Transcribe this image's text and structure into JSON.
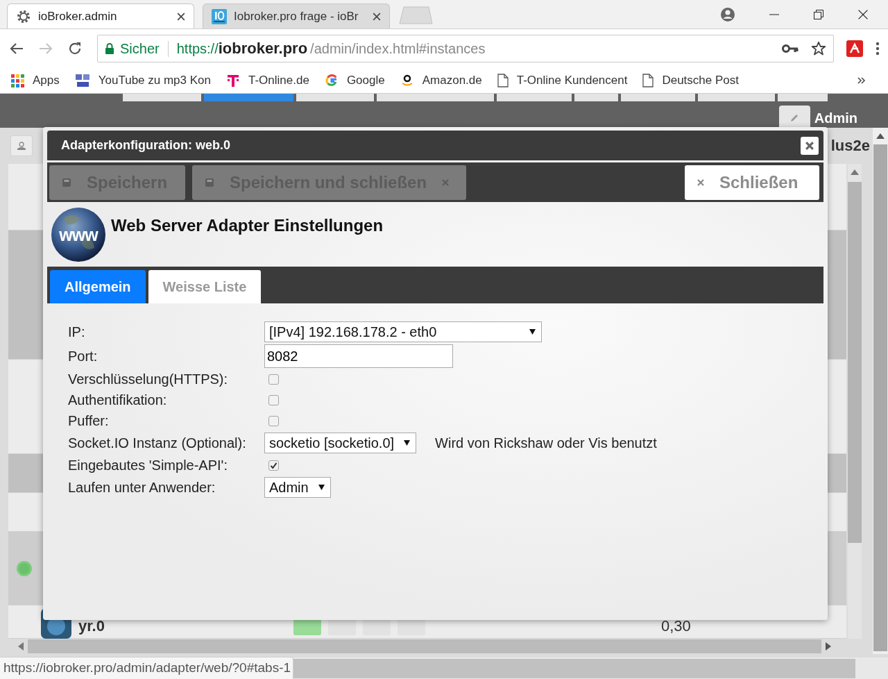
{
  "browser": {
    "tabs": [
      {
        "title": "ioBroker.admin",
        "kind": "gear",
        "selected": true
      },
      {
        "title": "Iobroker.pro frage - ioBr",
        "kind": "site",
        "selected": false
      }
    ],
    "address": {
      "security": "Sicher",
      "scheme": "https://",
      "host": "iobroker.pro",
      "path": "/admin/index.html#instances"
    },
    "bookmarks": [
      {
        "label": "Apps",
        "kind": "apps"
      },
      {
        "label": "YouTube zu mp3 Kon",
        "kind": "mp3"
      },
      {
        "label": "T-Online.de",
        "kind": "telekom"
      },
      {
        "label": "Google",
        "kind": "google"
      },
      {
        "label": "Amazon.de",
        "kind": "amazon"
      },
      {
        "label": "T-Online Kundencent",
        "kind": "page"
      },
      {
        "label": "Deutsche Post",
        "kind": "page"
      }
    ],
    "status_url": "https://iobroker.pro/admin/adapter/web/?0#tabs-1"
  },
  "app": {
    "nav_tabs": [
      {
        "selected": false
      },
      {
        "selected": true
      },
      {
        "selected": false
      },
      {
        "selected": false
      },
      {
        "selected": false
      },
      {
        "selected": false
      },
      {
        "selected": false
      },
      {
        "selected": false
      },
      {
        "selected": false
      }
    ],
    "user": "Admin",
    "host": "lus2e",
    "last_row": {
      "name": "yr.0",
      "value": "0,30"
    }
  },
  "dialog": {
    "title": "Adapterkonfiguration: web.0",
    "buttons": [
      {
        "label": "Speichern",
        "kind": "save",
        "disabled": true
      },
      {
        "label": "Speichern und schließen",
        "kind": "save_close",
        "disabled": true
      },
      {
        "label": "Schließen",
        "kind": "close",
        "disabled": false
      }
    ],
    "logo_text": "www",
    "heading": "Web Server Adapter Einstellungen",
    "tabs": [
      {
        "label": "Allgemein",
        "selected": true
      },
      {
        "label": "Weisse Liste",
        "selected": false
      }
    ],
    "fields": [
      {
        "label": "IP:",
        "kind": "select",
        "value": "[IPv4] 192.168.178.2 - eth0"
      },
      {
        "label": "Port:",
        "kind": "text",
        "value": "8082"
      },
      {
        "label": "Verschlüsselung(HTTPS):",
        "kind": "checkbox",
        "checked": false
      },
      {
        "label": "Authentifikation:",
        "kind": "checkbox",
        "checked": false
      },
      {
        "label": "Puffer:",
        "kind": "checkbox",
        "checked": false
      },
      {
        "label": "Socket.IO Instanz (Optional):",
        "kind": "select",
        "value": "socketio [socketio.0]",
        "note": "Wird von Rickshaw oder Vis benutzt"
      },
      {
        "label": "Eingebautes 'Simple-API':",
        "kind": "checkbox",
        "checked": true
      },
      {
        "label": "Laufen unter Anwender:",
        "kind": "select",
        "value": "Admin"
      }
    ]
  }
}
